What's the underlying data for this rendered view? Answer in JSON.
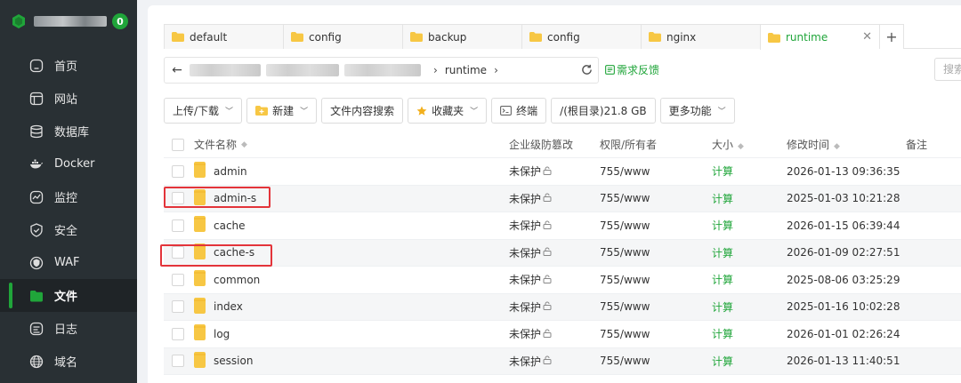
{
  "sidebar": {
    "badge": "0",
    "items": [
      {
        "label": "首页",
        "icon": "home-icon"
      },
      {
        "label": "网站",
        "icon": "website-icon"
      },
      {
        "label": "数据库",
        "icon": "database-icon"
      },
      {
        "label": "Docker",
        "icon": "docker-icon"
      },
      {
        "label": "监控",
        "icon": "monitor-icon"
      },
      {
        "label": "安全",
        "icon": "shield-icon"
      },
      {
        "label": "WAF",
        "icon": "waf-icon"
      },
      {
        "label": "文件",
        "icon": "folder-icon"
      },
      {
        "label": "日志",
        "icon": "log-icon"
      },
      {
        "label": "域名",
        "icon": "globe-icon"
      }
    ],
    "active_index": 7
  },
  "tabs": [
    {
      "label": "default"
    },
    {
      "label": "config"
    },
    {
      "label": "backup"
    },
    {
      "label": "config"
    },
    {
      "label": "nginx"
    },
    {
      "label": "runtime",
      "active": true
    }
  ],
  "pathbar": {
    "current": "runtime",
    "feedback": "需求反馈"
  },
  "search": {
    "placeholder": "搜索"
  },
  "toolbar": {
    "upload": "上传/下载",
    "new": "新建",
    "content_search": "文件内容搜索",
    "favorites": "收藏夹",
    "terminal": "终端",
    "disk": "/(根目录)21.8 GB",
    "more": "更多功能"
  },
  "table": {
    "headers": {
      "name": "文件名称",
      "protect": "企业级防篡改",
      "perm": "权限/所有者",
      "size": "大小",
      "mtime": "修改时间",
      "note": "备注"
    },
    "rows": [
      {
        "name": "admin",
        "protect": "未保护",
        "perm": "755/www",
        "size": "计算",
        "mtime": "2026-01-13 09:36:35"
      },
      {
        "name": "admin-s",
        "protect": "未保护",
        "perm": "755/www",
        "size": "计算",
        "mtime": "2025-01-03 10:21:28"
      },
      {
        "name": "cache",
        "protect": "未保护",
        "perm": "755/www",
        "size": "计算",
        "mtime": "2026-01-15 06:39:44"
      },
      {
        "name": "cache-s",
        "protect": "未保护",
        "perm": "755/www",
        "size": "计算",
        "mtime": "2026-01-09 02:27:51"
      },
      {
        "name": "common",
        "protect": "未保护",
        "perm": "755/www",
        "size": "计算",
        "mtime": "2025-08-06 03:25:29"
      },
      {
        "name": "index",
        "protect": "未保护",
        "perm": "755/www",
        "size": "计算",
        "mtime": "2025-01-16 10:02:28"
      },
      {
        "name": "log",
        "protect": "未保护",
        "perm": "755/www",
        "size": "计算",
        "mtime": "2026-01-01 02:26:24"
      },
      {
        "name": "session",
        "protect": "未保护",
        "perm": "755/www",
        "size": "计算",
        "mtime": "2026-01-13 11:40:51"
      }
    ]
  },
  "colors": {
    "accent": "#20a53a",
    "sidebar_bg": "#293034",
    "highlight": "#e3343a"
  }
}
